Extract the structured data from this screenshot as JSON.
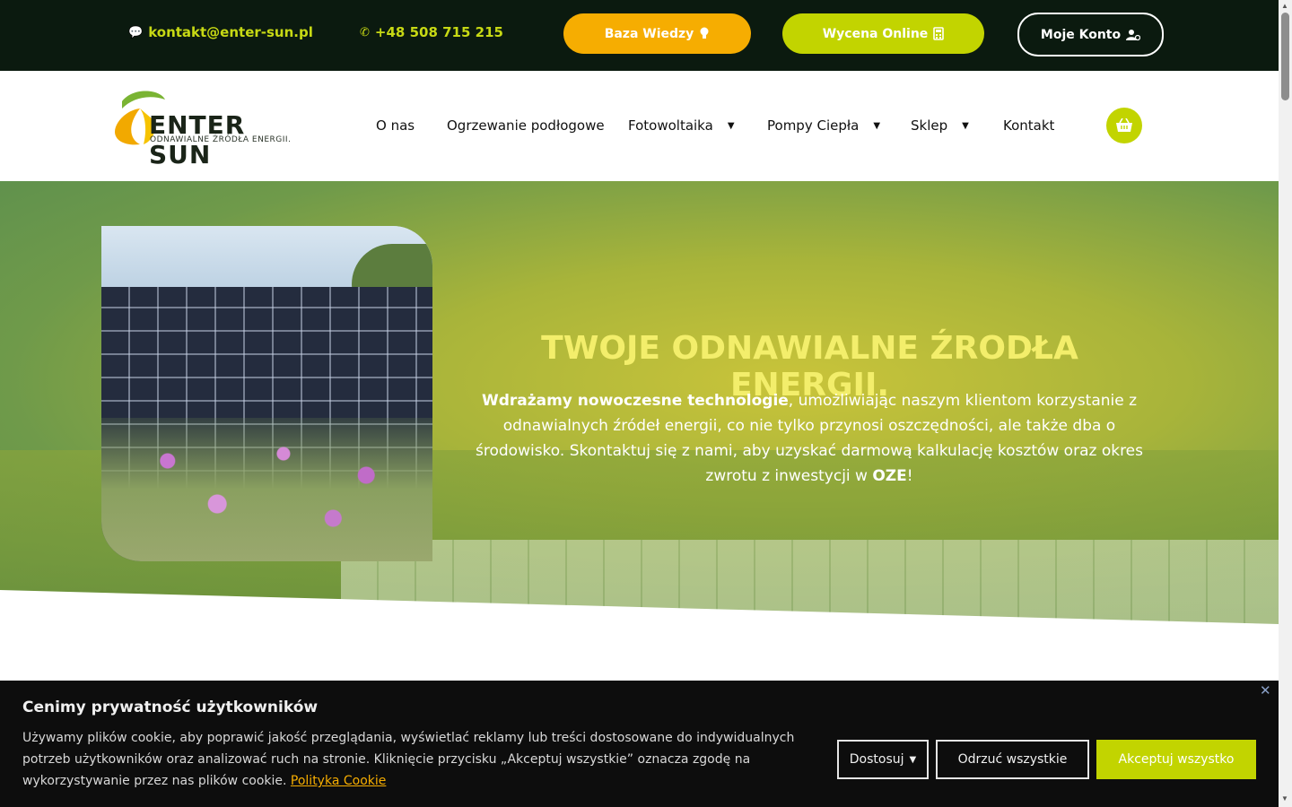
{
  "topbar": {
    "email": "kontakt@enter-sun.pl",
    "phone": "+48 508 715 215",
    "baza_wiedzy": "Baza Wiedzy",
    "wycena_online": "Wycena Online",
    "moje_konto": "Moje Konto"
  },
  "logo": {
    "name": "ENTER SUN",
    "tagline": "ODNAWIALNE ŹRÓDŁA ENERGII."
  },
  "nav": {
    "items": [
      {
        "label": "O nas"
      },
      {
        "label": "Ogrzewanie podłogowe"
      },
      {
        "label": "Fotowoltaika"
      },
      {
        "label": "Pompy Ciepła"
      },
      {
        "label": "Sklep"
      },
      {
        "label": "Kontakt"
      }
    ],
    "cart_icon": "basket-icon"
  },
  "hero": {
    "title": "TWOJE ODNAWIALNE ŹRODŁA ENERGII.",
    "text_bold": "Wdrażamy nowoczesne technologie",
    "text_main": ", umożliwiając naszym klientom korzystanie z odnawialnych źródeł energii, co nie tylko przynosi oszczędności, ale także dba o środowisko. Skontaktuj się z nami, aby uzyskać darmową kalkulację kosztów oraz okres zwrotu z inwestycji w ",
    "text_oze": "OZE",
    "text_end": "!"
  },
  "cookie": {
    "title": "Cenimy prywatność użytkowników",
    "text": "Używamy plików cookie, aby poprawić jakość przeglądania, wyświetlać reklamy lub treści dostosowane do indywidualnych potrzeb użytkowników oraz analizować ruch na stronie. Kliknięcie przycisku „Akceptuj wszystkie” oznacza zgodę na wykorzystywanie przez nas plików cookie. ",
    "link": "Polityka Cookie",
    "customize": "Dostosuj",
    "reject": "Odrzuć wszystkie",
    "accept": "Akceptuj wszystko"
  },
  "colors": {
    "accent_green": "#c2d400",
    "accent_orange": "#f6ad01",
    "topbar_bg": "#0b1a0f"
  }
}
